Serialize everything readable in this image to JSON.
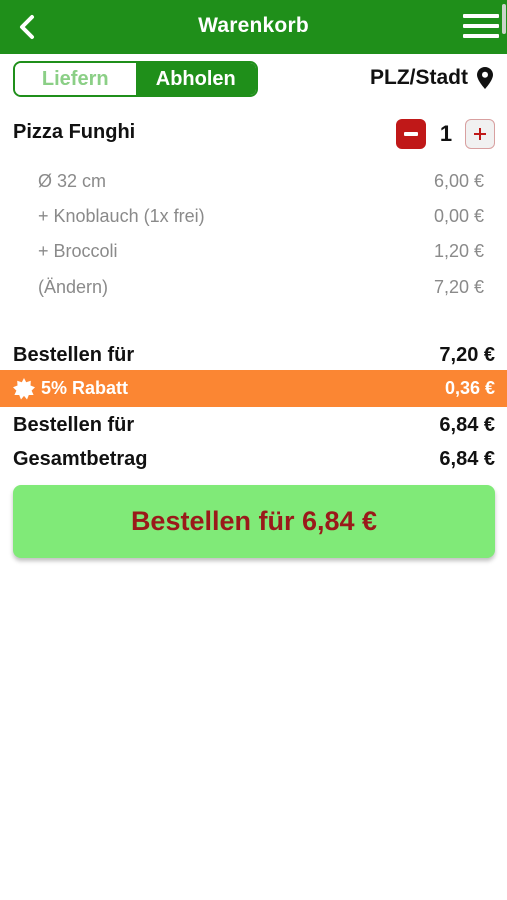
{
  "header": {
    "title": "Warenkorb",
    "back_icon": "chevron-left-icon",
    "menu_icon": "hamburger-menu-icon",
    "bg_color": "#1f8f1a"
  },
  "mode_toggle": {
    "options": [
      "Liefern",
      "Abholen"
    ],
    "selected": "Abholen"
  },
  "location": {
    "label": "PLZ/Stadt",
    "icon": "map-pin-icon"
  },
  "cart_item": {
    "name": "Pizza Funghi",
    "quantity": "1",
    "minus_icon": "minus-icon",
    "plus_icon": "plus-icon",
    "details": [
      {
        "label": "Ø 32 cm",
        "price": "6,00 €"
      },
      {
        "label": "+ Knoblauch (1x frei)",
        "price": "0,00 €"
      },
      {
        "label": "+ Broccoli",
        "price": "1,20 €"
      },
      {
        "label": "(Ändern)",
        "price": "7,20 €"
      }
    ]
  },
  "summary": {
    "subtotal_label": "Bestellen für",
    "subtotal_value": "7,20 €",
    "discount_label": "5% Rabatt",
    "discount_value": "0,36 €",
    "discount_icon": "starburst-badge-icon",
    "discount_color": "#fb8633",
    "after_discount_label": "Bestellen für",
    "after_discount_value": "6,84 €",
    "total_label": "Gesamtbetrag",
    "total_value": "6,84 €"
  },
  "order_button": {
    "label": "Bestellen für 6,84 €",
    "bg_color": "#80ea78",
    "text_color": "#9a1a1a"
  }
}
